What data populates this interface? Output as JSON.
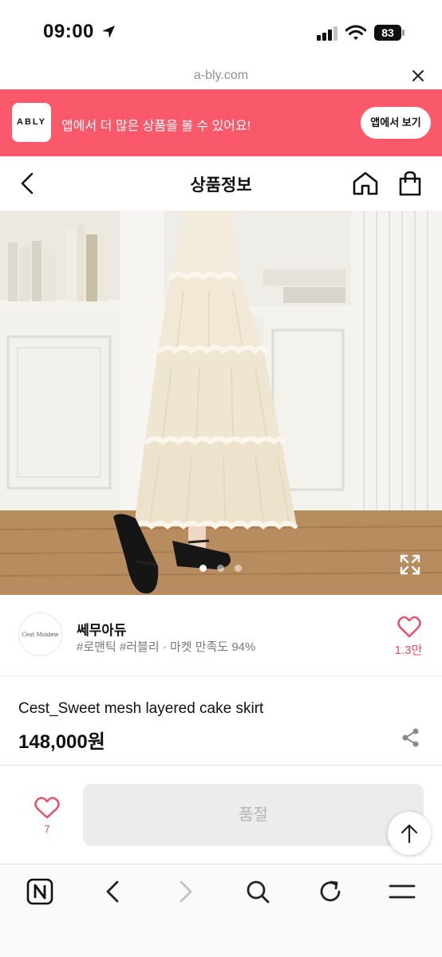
{
  "status_bar": {
    "time": "09:00",
    "battery": "83"
  },
  "browser": {
    "url": "a-bly.com"
  },
  "app_banner": {
    "logo_text": "ABLY",
    "message": "앱에서 더 많은 상품을 볼 수 있어요!",
    "open_button": "앱에서 보기",
    "accent_color": "#f9596b"
  },
  "header": {
    "title": "상품정보"
  },
  "gallery": {
    "image_count": 3,
    "active_index": 0
  },
  "seller": {
    "name": "쎄무아듀",
    "logo_text": "Cest Moidew",
    "tags": "#로맨틱 #러블리 · 마켓 만족도 94%",
    "like_count": "1.3만"
  },
  "product": {
    "name": "Cest_Sweet mesh layered cake skirt",
    "price": "148,000원"
  },
  "purchase": {
    "wish_count": "7",
    "button_label": "품절"
  },
  "icons": {
    "back": "chevron-left-icon",
    "home": "home-icon",
    "cart": "shopping-bag-icon",
    "share": "share-icon",
    "heart": "heart-icon",
    "expand": "expand-icon",
    "scroll_top": "arrow-up-icon"
  }
}
